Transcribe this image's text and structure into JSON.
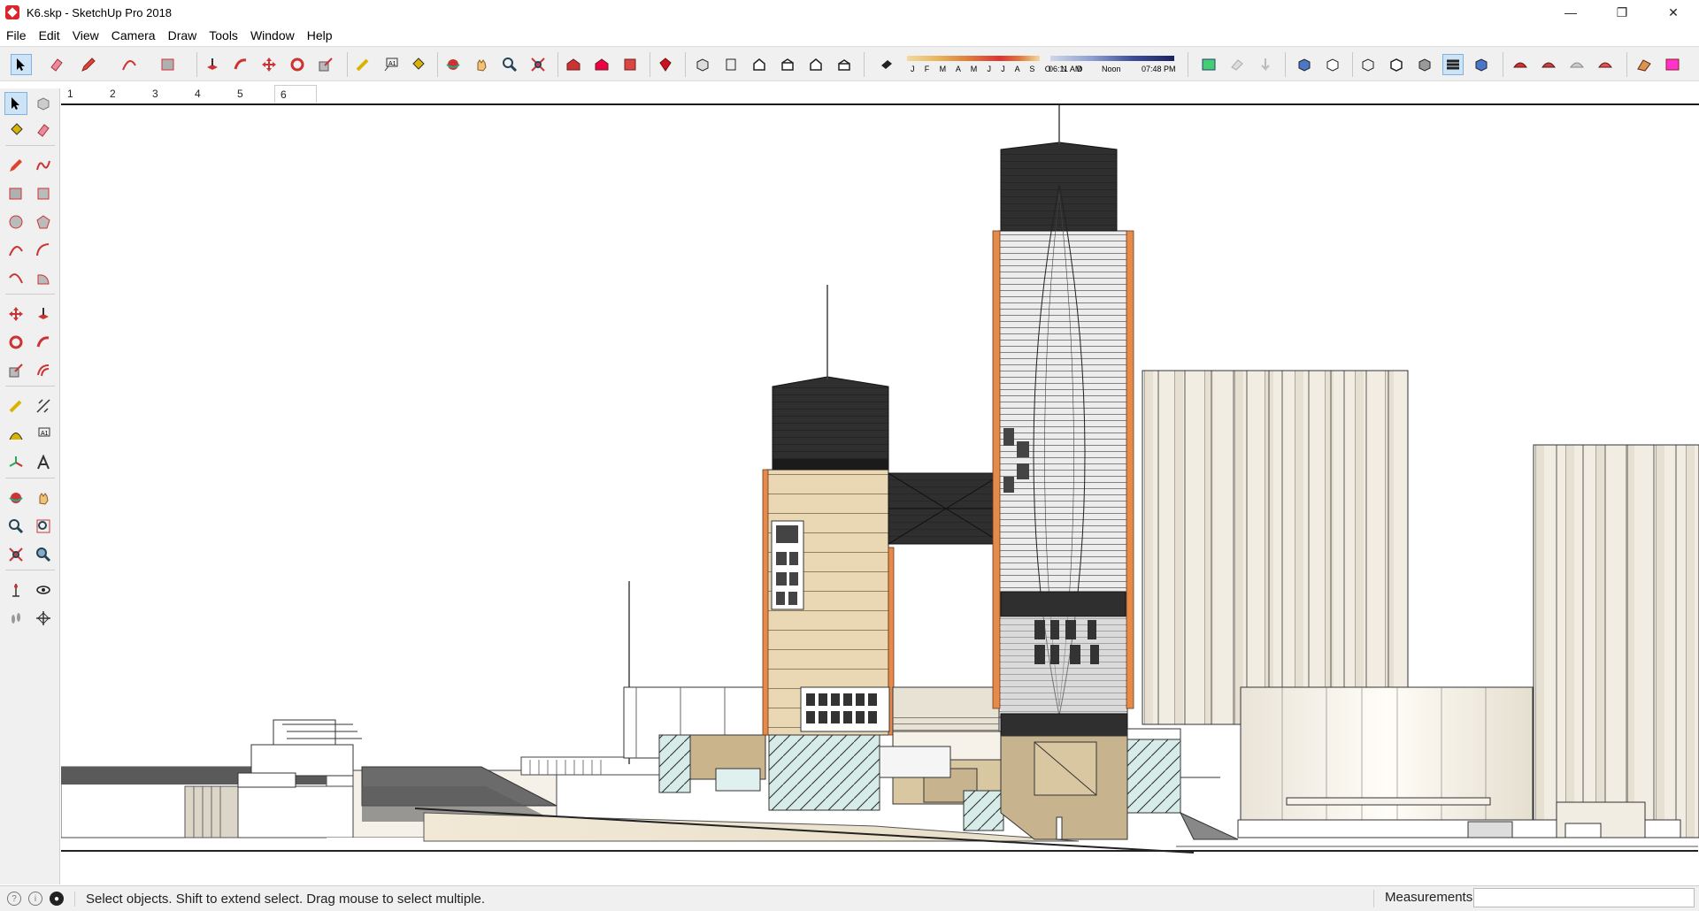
{
  "window": {
    "title": "K6.skp - SketchUp Pro 2018",
    "minimize": "—",
    "restore": "❐",
    "close": "✕"
  },
  "menu": [
    "File",
    "Edit",
    "View",
    "Camera",
    "Draw",
    "Tools",
    "Window",
    "Help"
  ],
  "shadows": {
    "months": "J F M A M J J A S O N D",
    "time_start": "06:11 AM",
    "time_mid": "Noon",
    "time_end": "07:48 PM"
  },
  "scenes": [
    "1",
    "2",
    "3",
    "4",
    "5",
    "6"
  ],
  "active_scene": "6",
  "status": {
    "message": "Select objects. Shift to extend select. Drag mouse to select multiple.",
    "measurements_label": "Measurements",
    "measurements_value": ""
  },
  "toolbar_icons": [
    "select-icon",
    "eraser-icon",
    "pencil-icon",
    "arc-icon",
    "shape-icon",
    "push-pull-icon",
    "follow-me-icon",
    "move-icon",
    "rotate-icon",
    "scale-icon",
    "tape-measure-icon",
    "text-icon",
    "paint-bucket-icon",
    "orbit-icon",
    "pan-icon",
    "zoom-icon",
    "zoom-extents-icon",
    "warehouse-icon",
    "extension-warehouse-icon",
    "layout-icon",
    "ruby-icon",
    "iso-view-icon",
    "top-view-icon",
    "front-view-icon",
    "right-view-icon",
    "back-view-icon",
    "left-view-icon",
    "shadows-icon",
    "fog-icon",
    "xray-icon",
    "wireframe-icon",
    "hidden-line-icon",
    "shaded-icon",
    "shaded-texture-icon",
    "monochrome-icon",
    "section-plane-icon",
    "sandbox-icon"
  ],
  "colors": {
    "toolbar_bg": "#f0f0f0",
    "tower_dark": "#2f2f2f",
    "tower_glass": "#ececec",
    "orange_fin": "#e58a4a",
    "beige": "#ead7b4",
    "cream": "#f3efe6"
  }
}
